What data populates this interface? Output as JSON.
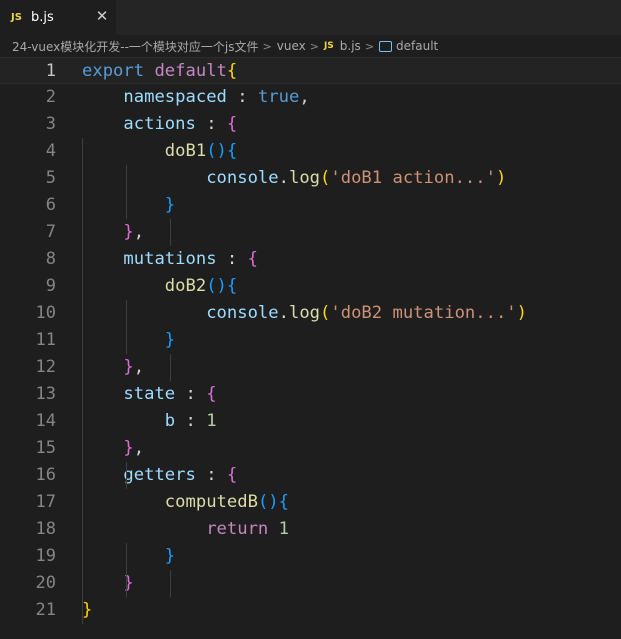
{
  "tab": {
    "icon": "JS",
    "title": "b.js",
    "close": "✕"
  },
  "breadcrumb": {
    "folder": "24-vuex模块化开发--一个模块对应一个js文件",
    "subfolder": "vuex",
    "file_icon": "JS",
    "file": "b.js",
    "symbol": "default",
    "separator": ">"
  },
  "editor": {
    "active_line": 1,
    "lines": [
      {
        "n": "1",
        "tokens": [
          [
            "kw-blue",
            "export"
          ],
          [
            "punc",
            " "
          ],
          [
            "kw",
            "default"
          ],
          [
            "b1",
            "{"
          ]
        ]
      },
      {
        "n": "2",
        "tokens": [
          [
            "punc",
            "    "
          ],
          [
            "prop",
            "namespaced"
          ],
          [
            "punc",
            " : "
          ],
          [
            "kw-blue",
            "true"
          ],
          [
            "punc",
            ","
          ]
        ]
      },
      {
        "n": "3",
        "tokens": [
          [
            "punc",
            "    "
          ],
          [
            "prop",
            "actions"
          ],
          [
            "punc",
            " : "
          ],
          [
            "b2",
            "{"
          ]
        ]
      },
      {
        "n": "4",
        "tokens": [
          [
            "punc",
            "        "
          ],
          [
            "fn",
            "doB1"
          ],
          [
            "b3",
            "()"
          ],
          [
            "b3",
            "{"
          ]
        ]
      },
      {
        "n": "5",
        "tokens": [
          [
            "punc",
            "            "
          ],
          [
            "var",
            "console"
          ],
          [
            "punc",
            "."
          ],
          [
            "fn",
            "log"
          ],
          [
            "b1",
            "("
          ],
          [
            "str",
            "'doB1 action...'"
          ],
          [
            "b1",
            ")"
          ]
        ]
      },
      {
        "n": "6",
        "tokens": [
          [
            "punc",
            "        "
          ],
          [
            "b3",
            "}"
          ]
        ]
      },
      {
        "n": "7",
        "tokens": [
          [
            "punc",
            "    "
          ],
          [
            "b2",
            "}"
          ],
          [
            "punc",
            ","
          ]
        ]
      },
      {
        "n": "8",
        "tokens": [
          [
            "punc",
            "    "
          ],
          [
            "prop",
            "mutations"
          ],
          [
            "punc",
            " : "
          ],
          [
            "b2",
            "{"
          ]
        ]
      },
      {
        "n": "9",
        "tokens": [
          [
            "punc",
            "        "
          ],
          [
            "fn",
            "doB2"
          ],
          [
            "b3",
            "()"
          ],
          [
            "b3",
            "{"
          ]
        ]
      },
      {
        "n": "10",
        "tokens": [
          [
            "punc",
            "            "
          ],
          [
            "var",
            "console"
          ],
          [
            "punc",
            "."
          ],
          [
            "fn",
            "log"
          ],
          [
            "b1",
            "("
          ],
          [
            "str",
            "'doB2 mutation...'"
          ],
          [
            "b1",
            ")"
          ]
        ]
      },
      {
        "n": "11",
        "tokens": [
          [
            "punc",
            "        "
          ],
          [
            "b3",
            "}"
          ]
        ]
      },
      {
        "n": "12",
        "tokens": [
          [
            "punc",
            "    "
          ],
          [
            "b2",
            "}"
          ],
          [
            "punc",
            ","
          ]
        ]
      },
      {
        "n": "13",
        "tokens": [
          [
            "punc",
            "    "
          ],
          [
            "prop",
            "state"
          ],
          [
            "punc",
            " : "
          ],
          [
            "b2",
            "{"
          ]
        ]
      },
      {
        "n": "14",
        "tokens": [
          [
            "punc",
            "        "
          ],
          [
            "prop",
            "b"
          ],
          [
            "punc",
            " : "
          ],
          [
            "num",
            "1"
          ]
        ]
      },
      {
        "n": "15",
        "tokens": [
          [
            "punc",
            "    "
          ],
          [
            "b2",
            "}"
          ],
          [
            "punc",
            ","
          ]
        ]
      },
      {
        "n": "16",
        "tokens": [
          [
            "punc",
            "    "
          ],
          [
            "prop",
            "getters"
          ],
          [
            "punc",
            " : "
          ],
          [
            "b2",
            "{"
          ]
        ]
      },
      {
        "n": "17",
        "tokens": [
          [
            "punc",
            "        "
          ],
          [
            "fn",
            "computedB"
          ],
          [
            "b3",
            "()"
          ],
          [
            "b3",
            "{"
          ]
        ]
      },
      {
        "n": "18",
        "tokens": [
          [
            "punc",
            "            "
          ],
          [
            "kw",
            "return"
          ],
          [
            "punc",
            " "
          ],
          [
            "num",
            "1"
          ]
        ]
      },
      {
        "n": "19",
        "tokens": [
          [
            "punc",
            "        "
          ],
          [
            "b3",
            "}"
          ]
        ]
      },
      {
        "n": "20",
        "tokens": [
          [
            "punc",
            "    "
          ],
          [
            "b2",
            "}"
          ]
        ]
      },
      {
        "n": "21",
        "tokens": [
          [
            "b1",
            "}"
          ]
        ]
      }
    ]
  },
  "colors": {
    "background": "#1e1e1e",
    "keyword": "#c586c0",
    "keyword_blue": "#569cd6",
    "property": "#9cdcfe",
    "function": "#dcdcaa",
    "string": "#ce9178",
    "number": "#b5cea8",
    "bracket_1": "#ffd700",
    "bracket_2": "#da70d6",
    "bracket_3": "#179fff"
  }
}
